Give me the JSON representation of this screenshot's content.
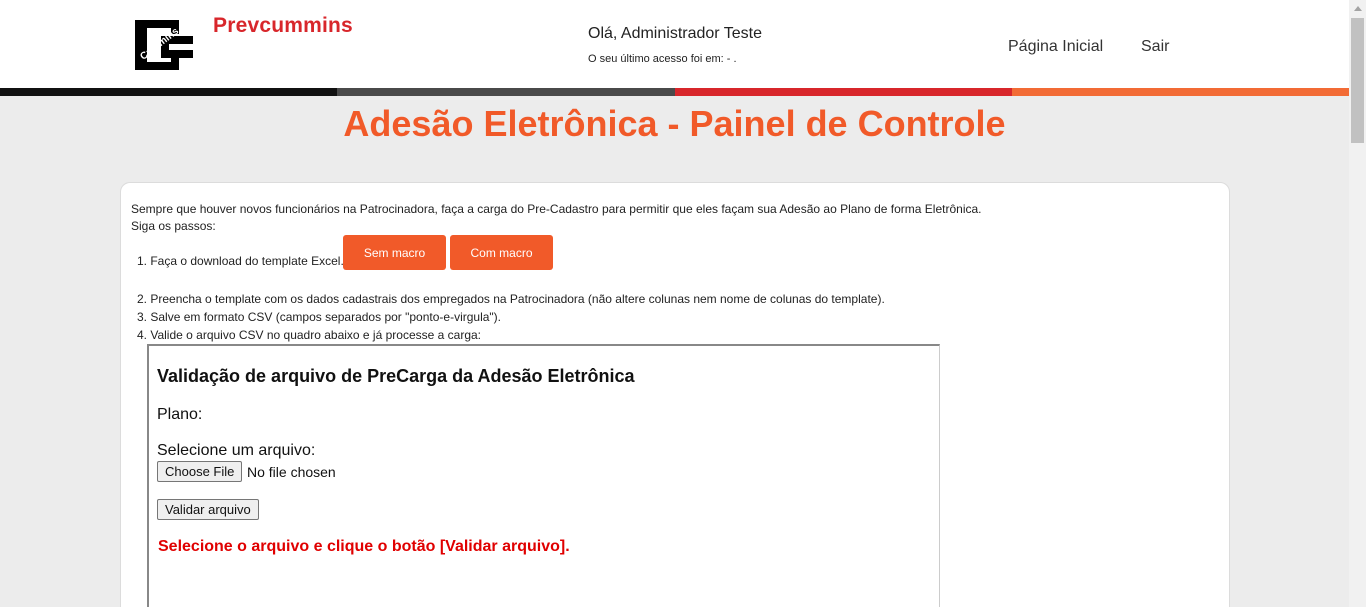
{
  "header": {
    "brand": "Prevcummins",
    "logo_text": "Cummins",
    "greeting": "Olá, Administrador Teste",
    "last_access": "O seu último acesso foi em: - .",
    "nav": {
      "home": "Página Inicial",
      "exit": "Sair"
    }
  },
  "colors": {
    "stripes": [
      "#111111",
      "#4a4a4a",
      "#d8262b",
      "#f26b35"
    ],
    "accent": "#f15a29",
    "error": "#e00000"
  },
  "page": {
    "title": "Adesão Eletrônica - Painel de Controle"
  },
  "intro": {
    "line1": "Sempre que houver novos funcionários na Patrocinadora, faça a carga do Pre-Cadastro para permitir que eles façam sua Adesão ao Plano de forma Eletrônica.",
    "line2": "Siga os passos:"
  },
  "steps": [
    {
      "num": "1.",
      "text": "Faça o download do template Excel."
    },
    {
      "num": "2.",
      "text": "Preencha o template com os dados cadastrais dos empregados na Patrocinadora (não altere colunas nem nome de colunas do template)."
    },
    {
      "num": "3.",
      "text": "Salve em formato CSV (campos separados por \"ponto-e-virgula\")."
    },
    {
      "num": "4.",
      "text": "Valide o arquivo CSV no quadro abaixo e já processe a carga:"
    }
  ],
  "download_buttons": {
    "without_macro": "Sem macro",
    "with_macro": "Com macro"
  },
  "validation": {
    "title": "Validação de arquivo de PreCarga da Adesão Eletrônica",
    "plan_label": "Plano:",
    "select_label": "Selecione um arquivo:",
    "choose_file": "Choose File",
    "no_file": "No file chosen",
    "validate_button": "Validar arquivo",
    "message": "Selecione o arquivo e clique o botão [Validar arquivo]."
  }
}
